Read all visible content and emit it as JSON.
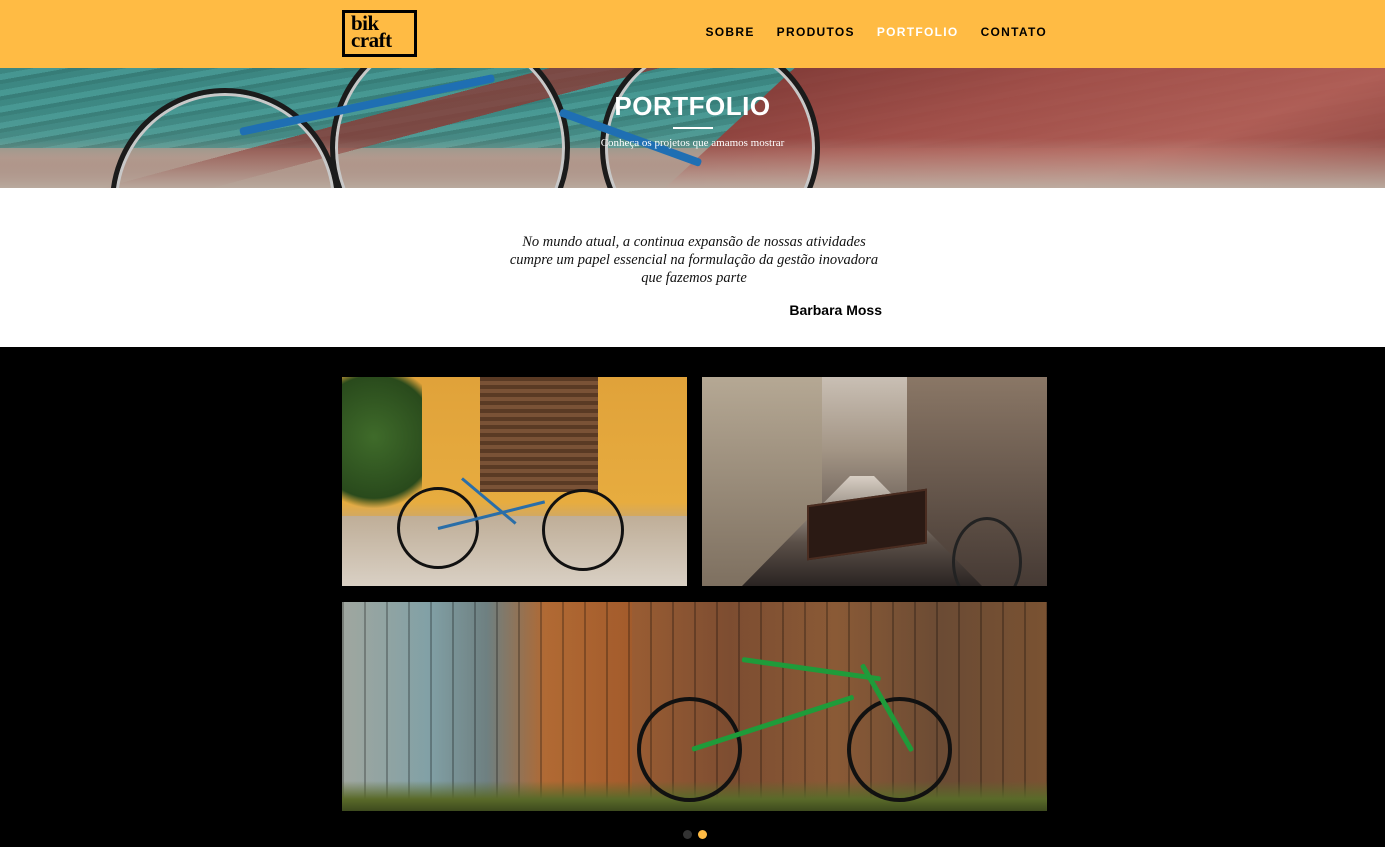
{
  "header": {
    "logo": {
      "line1": "bik",
      "line2": "craft"
    },
    "nav": [
      {
        "label": "SOBRE",
        "active": false
      },
      {
        "label": "PRODUTOS",
        "active": false
      },
      {
        "label": "PORTFOLIO",
        "active": true
      },
      {
        "label": "CONTATO",
        "active": false
      }
    ],
    "accent_color": "#ffbb44"
  },
  "hero": {
    "title": "PORTFOLIO",
    "subtitle": "Conheça os projetos que amamos mostrar"
  },
  "quote": {
    "text": "No mundo atual, a continua expansão de nossas atividades cumpre um papel essencial na formulação da gestão inovadora que fazemos parte",
    "author": "Barbara Moss"
  },
  "gallery": {
    "photos": [
      {
        "subject": "blue bicycle against yellow wall"
      },
      {
        "subject": "bicycle with basket on city street"
      },
      {
        "subject": "green bicycle against wooden fence"
      }
    ],
    "slider": {
      "pages": 2,
      "active_page": 2
    }
  }
}
